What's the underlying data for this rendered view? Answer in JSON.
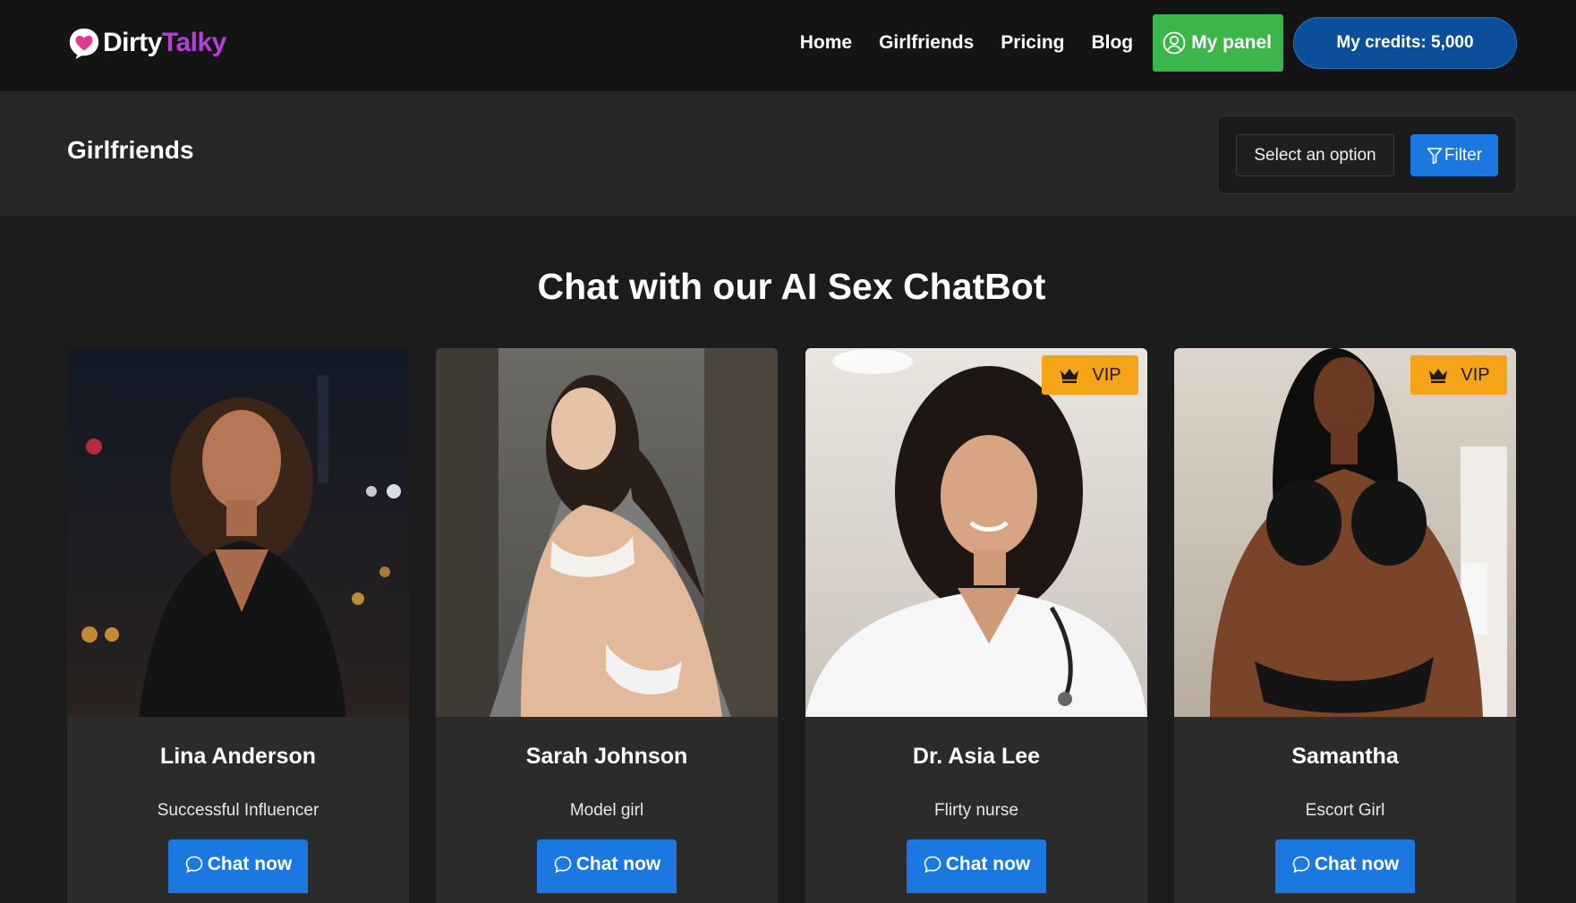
{
  "brand": {
    "name_part1": "Dirty",
    "name_part2": "Talky",
    "accent_color": "#b43ed8"
  },
  "nav": {
    "links": [
      {
        "label": "Home"
      },
      {
        "label": "Girlfriends"
      },
      {
        "label": "Pricing"
      },
      {
        "label": "Blog"
      }
    ],
    "panel_label": "My panel",
    "panel_icon": "user-circle-icon",
    "credits_label": "My credits: 5,000"
  },
  "subheader": {
    "title": "Girlfriends",
    "select_placeholder": "Select an option",
    "filter_label": "Filter",
    "filter_icon": "funnel-icon"
  },
  "main": {
    "heading": "Chat with our AI Sex ChatBot",
    "cta_label": "Chat now",
    "cta_icon": "chat-bubble-icon",
    "vip_label": "VIP",
    "vip_icon": "crown-icon",
    "vip_color": "#f5a418",
    "cards": [
      {
        "name": "Lina Anderson",
        "description": "Successful Influencer",
        "vip": false
      },
      {
        "name": "Sarah Johnson",
        "description": "Model girl",
        "vip": false
      },
      {
        "name": "Dr. Asia Lee",
        "description": "Flirty nurse",
        "vip": true
      },
      {
        "name": "Samantha",
        "description": "Escort Girl",
        "vip": true
      }
    ]
  },
  "colors": {
    "primary_blue": "#1a78e0",
    "panel_green": "#3cb54a",
    "credits_blue": "#0b4f9a"
  }
}
